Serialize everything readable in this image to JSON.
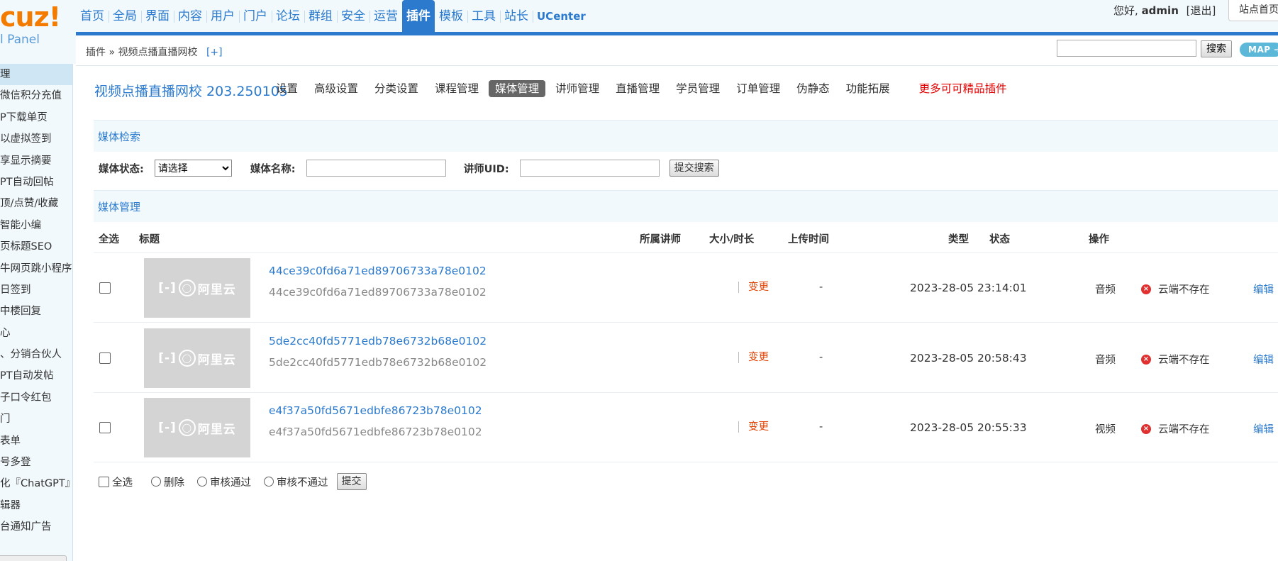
{
  "brand": {
    "logo": "cuz!",
    "sub": "l Panel"
  },
  "sidebar": {
    "items": [
      {
        "label": "理",
        "active": true
      },
      {
        "label": "微信积分充值"
      },
      {
        "label": "P下载单页"
      },
      {
        "label": "以虚拟签到"
      },
      {
        "label": "享显示摘要"
      },
      {
        "label": "PT自动回帖"
      },
      {
        "label": "顶/点赞/收藏"
      },
      {
        "label": "智能小编"
      },
      {
        "label": "页标题SEO"
      },
      {
        "label": "牛网页跳小程序"
      },
      {
        "label": "日签到"
      },
      {
        "label": "中楼回复"
      },
      {
        "label": "心"
      },
      {
        "label": "、分销合伙人"
      },
      {
        "label": "PT自动发帖"
      },
      {
        "label": "子口令红包"
      },
      {
        "label": "门"
      },
      {
        "label": "表单"
      },
      {
        "label": "号多登"
      },
      {
        "label": "化『ChatGPT』"
      },
      {
        "label": "辑器"
      },
      {
        "label": "台通知广告"
      }
    ]
  },
  "topnav": {
    "items": [
      {
        "label": "首页"
      },
      {
        "label": "全局"
      },
      {
        "label": "界面"
      },
      {
        "label": "内容"
      },
      {
        "label": "用户"
      },
      {
        "label": "门户"
      },
      {
        "label": "论坛"
      },
      {
        "label": "群组"
      },
      {
        "label": "安全"
      },
      {
        "label": "运营"
      },
      {
        "label": "插件",
        "active": true
      },
      {
        "label": "模板"
      },
      {
        "label": "工具"
      },
      {
        "label": "站长"
      },
      {
        "label": "UCenter"
      }
    ],
    "greeting_prefix": "您好,",
    "user": "admin",
    "logout": "[退出]",
    "home_link": "站点首页"
  },
  "breadcrumb": {
    "root": "插件",
    "sep": "»",
    "current": "视频点播直播网校",
    "add": "[+]"
  },
  "top_search": {
    "value": "",
    "button": "搜索",
    "map_button": "MAP ➜"
  },
  "plugin": {
    "title": "视频点播直播网校 203.250105",
    "tabs": [
      {
        "label": "设置"
      },
      {
        "label": "高级设置"
      },
      {
        "label": "分类设置"
      },
      {
        "label": "课程管理"
      },
      {
        "label": "媒体管理",
        "active": true
      },
      {
        "label": "讲师管理"
      },
      {
        "label": "直播管理"
      },
      {
        "label": "学员管理"
      },
      {
        "label": "订单管理"
      },
      {
        "label": "伪静态"
      },
      {
        "label": "功能拓展"
      },
      {
        "label": "更多可可精品插件",
        "hot": true
      }
    ]
  },
  "search_section": {
    "title": "媒体检索",
    "status_label": "媒体状态:",
    "status_selected": "请选择",
    "name_label": "媒体名称:",
    "name_value": "",
    "uid_label": "讲师UID:",
    "uid_value": "",
    "submit": "提交搜索"
  },
  "manage_section": {
    "title": "媒体管理",
    "columns": {
      "select_all": "全选",
      "title": "标题",
      "teacher": "所属讲师",
      "size": "大小/时长",
      "upload_time": "上传时间",
      "type": "类型",
      "status": "状态",
      "action": "操作"
    },
    "rows": [
      {
        "thumb_text": "阿里云",
        "title": "44ce39c0fd6a71ed89706733a78e0102",
        "subtitle": "44ce39c0fd6a71ed89706733a78e0102",
        "teacher_action": "变更",
        "size": "-",
        "time": "2023-28-05 23:14:01",
        "type": "音频",
        "status": "云端不存在",
        "edit": "编辑"
      },
      {
        "thumb_text": "阿里云",
        "title": "5de2cc40fd5771edb78e6732b68e0102",
        "subtitle": "5de2cc40fd5771edb78e6732b68e0102",
        "teacher_action": "变更",
        "size": "-",
        "time": "2023-28-05 20:58:43",
        "type": "音频",
        "status": "云端不存在",
        "edit": "编辑"
      },
      {
        "thumb_text": "阿里云",
        "title": "e4f37a50fd5671edbfe86723b78e0102",
        "subtitle": "e4f37a50fd5671edbfe86723b78e0102",
        "teacher_action": "变更",
        "size": "-",
        "time": "2023-28-05 20:55:33",
        "type": "视频",
        "status": "云端不存在",
        "edit": "编辑"
      }
    ],
    "footer": {
      "select_all": "全选",
      "delete": "删除",
      "approve": "审核通过",
      "reject": "审核不通过",
      "submit": "提交"
    }
  },
  "colors": {
    "accent": "#2b7acd",
    "hot": "#e20000",
    "change": "#e04000",
    "error": "#e03030"
  }
}
